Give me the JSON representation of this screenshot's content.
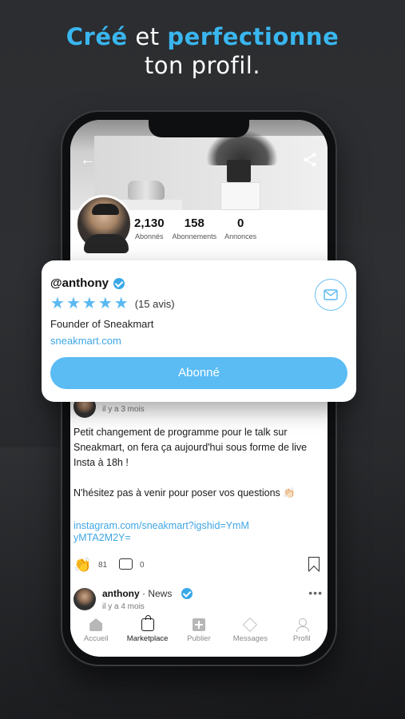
{
  "headline": {
    "line1_accent1": "Créé",
    "line1_mid": " et ",
    "line1_accent2": "perfectionne",
    "line2": "ton profil."
  },
  "profile": {
    "stats": [
      {
        "value": "2,130",
        "label": "Abonnés"
      },
      {
        "value": "158",
        "label": "Abonnements"
      },
      {
        "value": "0",
        "label": "Annonces"
      }
    ],
    "handle": "@anthony",
    "rating_stars": 5,
    "reviews": "(15 avis)",
    "bio": "Founder of Sneakmart",
    "website": "sneakmart.com",
    "follow_label": "Abonné"
  },
  "post": {
    "time": "il y a 3 mois",
    "text": "Petit changement de programme pour le talk sur Sneakmart, on fera ça aujourd'hui sous forme de live Insta à 18h !\n\nN'hésitez pas à venir pour poser vos questions 👏🏻",
    "link": "instagram.com/sneakmart?igshid=YmMyMTA2M2Y=",
    "claps": "81",
    "comments": "0"
  },
  "post2": {
    "author": "anthony",
    "category": " · News",
    "time": "il y a 4 mois"
  },
  "tabs": [
    {
      "label": "Accueil",
      "icon": "home-icon",
      "active": false
    },
    {
      "label": "Marketplace",
      "icon": "bag-icon",
      "active": true
    },
    {
      "label": "Publier",
      "icon": "plus-icon",
      "active": false
    },
    {
      "label": "Messages",
      "icon": "send-icon",
      "active": false
    },
    {
      "label": "Profil",
      "icon": "user-icon",
      "active": false
    }
  ],
  "colors": {
    "accent": "#39b6ef",
    "button": "#5bbcf4",
    "link": "#3fa6e4"
  }
}
